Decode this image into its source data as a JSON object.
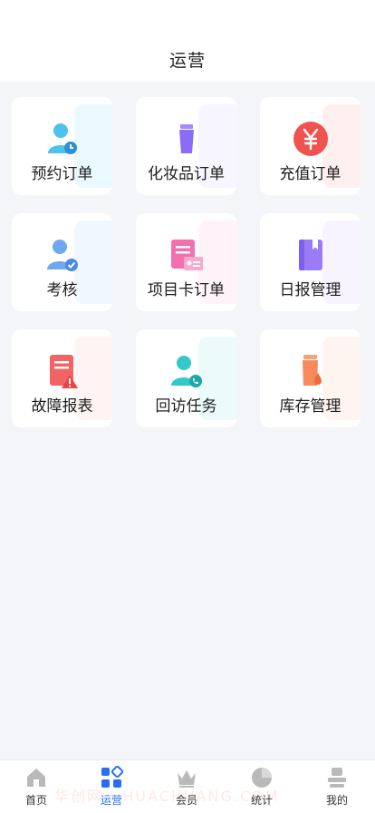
{
  "header": {
    "title": "运营"
  },
  "cards": [
    {
      "label": "预约订单",
      "icon": "appointment-person-clock-icon",
      "ghost": "#bfeefd"
    },
    {
      "label": "化妆品订单",
      "icon": "cosmetic-tube-icon",
      "ghost": "#e7e3ff"
    },
    {
      "label": "充值订单",
      "icon": "yen-coin-icon",
      "ghost": "#ffd4d4"
    },
    {
      "label": "考核",
      "icon": "person-check-icon",
      "ghost": "#d7e8ff"
    },
    {
      "label": "项目卡订单",
      "icon": "project-card-icon",
      "ghost": "#ffd9ec"
    },
    {
      "label": "日报管理",
      "icon": "notebook-icon",
      "ghost": "#e7e0ff"
    },
    {
      "label": "故障报表",
      "icon": "fault-report-icon",
      "ghost": "#ffdcdc"
    },
    {
      "label": "回访任务",
      "icon": "callback-person-phone-icon",
      "ghost": "#c9f1f2"
    },
    {
      "label": "库存管理",
      "icon": "inventory-bottle-icon",
      "ghost": "#ffe1d4"
    }
  ],
  "tabbar": {
    "items": [
      {
        "label": "首页",
        "icon": "home-icon"
      },
      {
        "label": "运营",
        "icon": "operations-grid-icon"
      },
      {
        "label": "会员",
        "icon": "crown-icon"
      },
      {
        "label": "统计",
        "icon": "pie-chart-icon"
      },
      {
        "label": "我的",
        "icon": "profile-icon"
      }
    ],
    "active_index": 1
  },
  "watermark": "华创网 · HUACHUANG.COM",
  "colors": {
    "accent": "#2a6df5",
    "background": "#f3f5f8"
  }
}
